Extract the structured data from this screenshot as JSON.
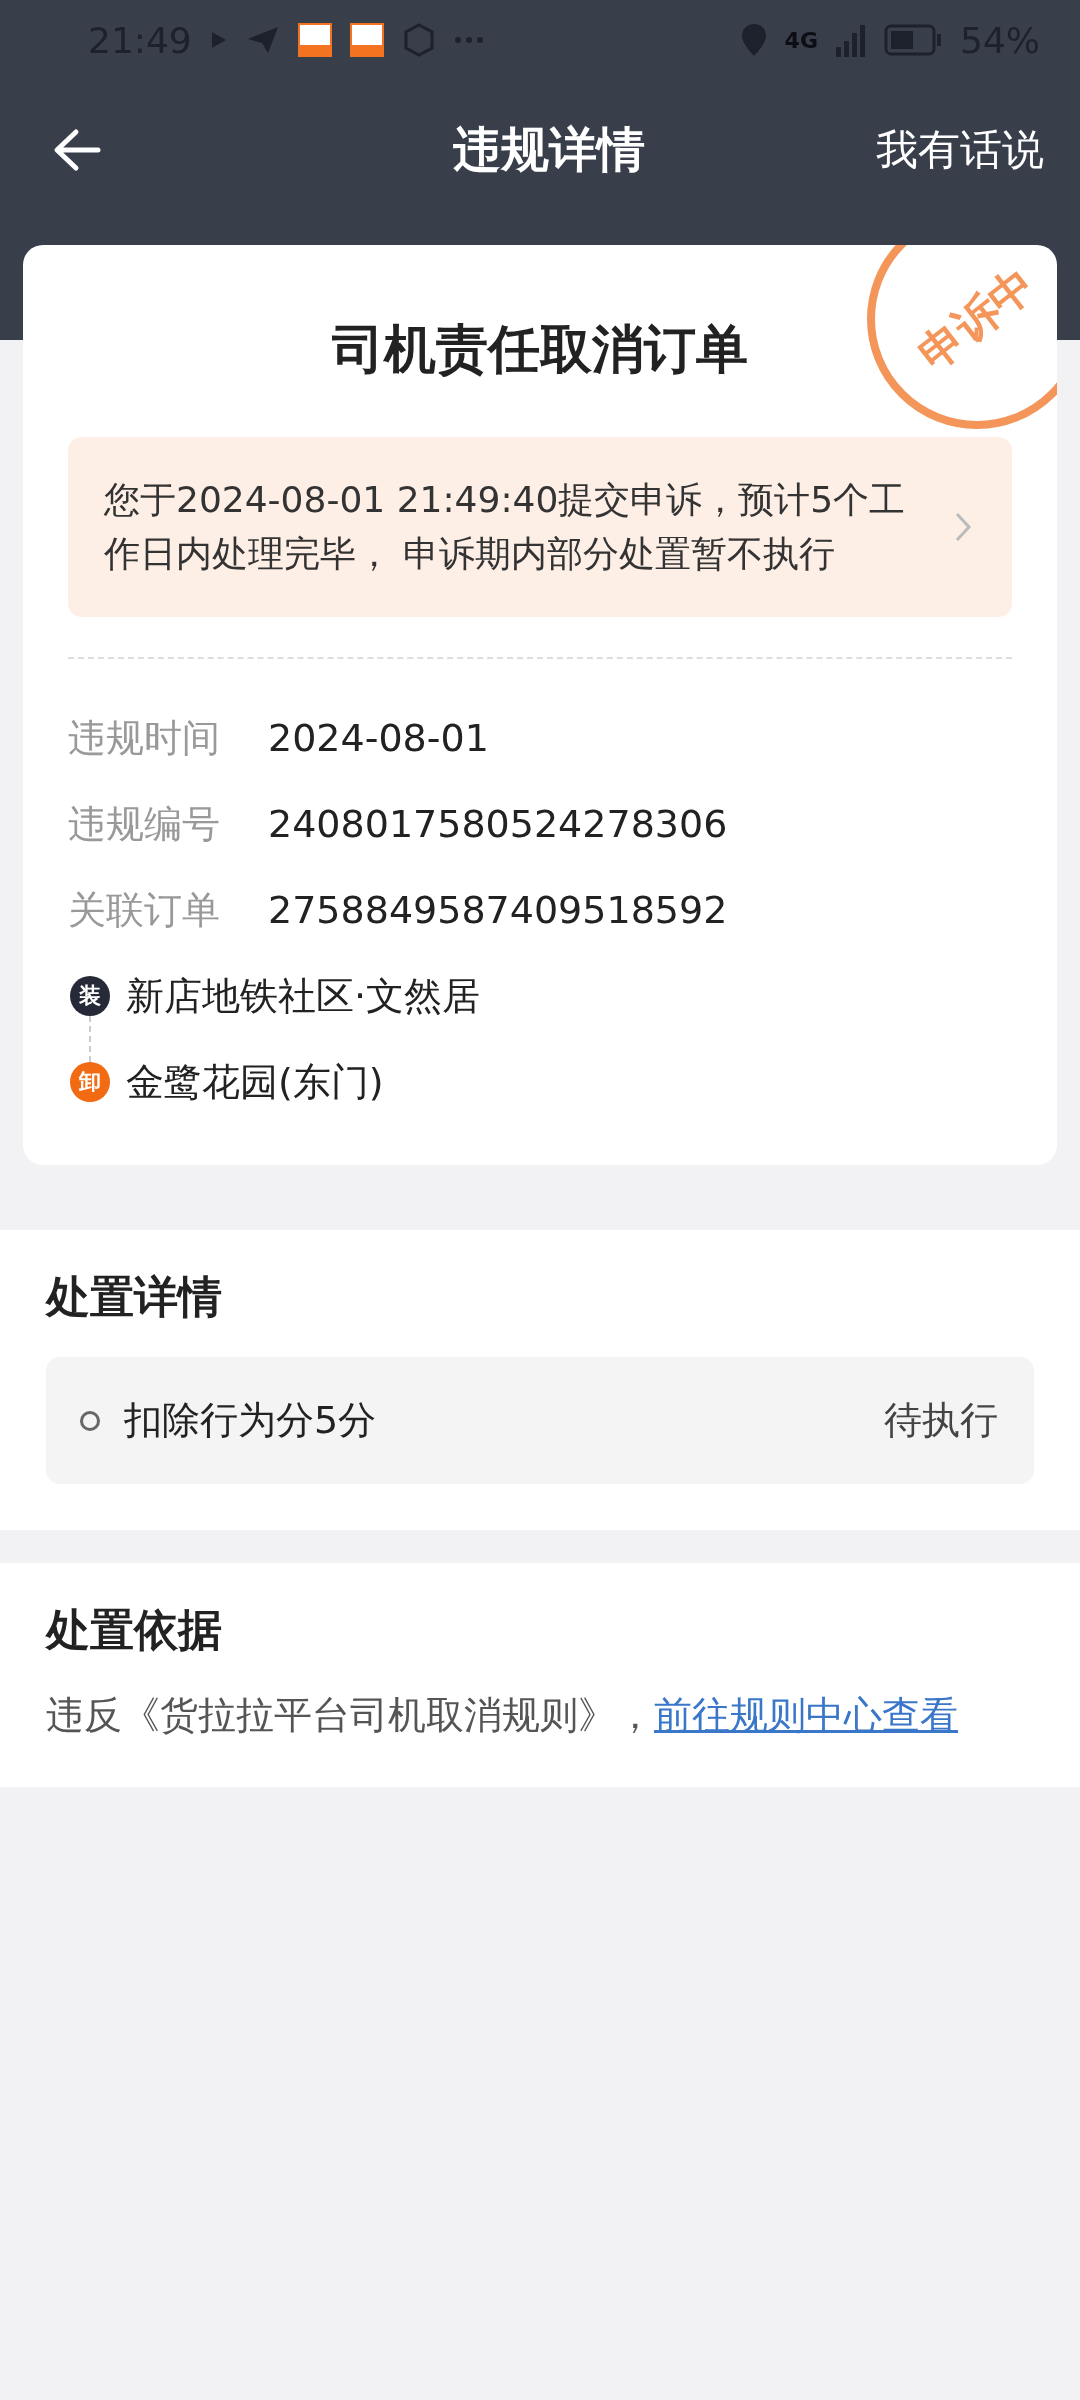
{
  "status_bar": {
    "time": "21:49",
    "network": "4G",
    "battery": "54%"
  },
  "nav": {
    "title": "违规详情",
    "action": "我有话说"
  },
  "card": {
    "title": "司机责任取消订单",
    "stamp": "申诉中",
    "notice": "您于2024-08-01 21:49:40提交申诉，预计5个工作日内处理完毕， 申诉期内部分处置暂不执行",
    "fields": [
      {
        "label": "违规时间",
        "value": "2024-08-01"
      },
      {
        "label": "违规编号",
        "value": "2408017580524278306"
      },
      {
        "label": "关联订单",
        "value": "2758849587409518592"
      }
    ],
    "route": [
      {
        "kind": "load",
        "badge": "装",
        "address": "新店地铁社区·文然居"
      },
      {
        "kind": "unload",
        "badge": "卸",
        "address": "金鹭花园(东门)"
      }
    ]
  },
  "penalty": {
    "title": "处置详情",
    "items": [
      {
        "text": "扣除行为分5分",
        "status": "待执行"
      }
    ]
  },
  "basis": {
    "title": "处置依据",
    "text": "违反《货拉拉平台司机取消规则》，",
    "link": "前往规则中心查看"
  }
}
